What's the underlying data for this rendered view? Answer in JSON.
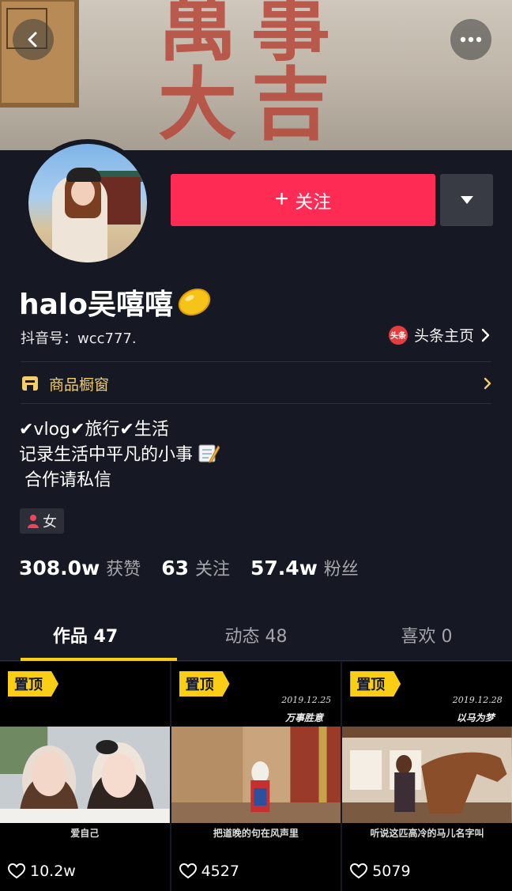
{
  "cover": {
    "calligraphy_line1": "萬事",
    "calligraphy_line2": "大吉"
  },
  "profile": {
    "follow_label": "关注",
    "nickname": "halo吴嘻嘻",
    "douyin_id": "抖音号：wcc777.",
    "toutiao_badge": "头条",
    "toutiao_label": "头条主页",
    "shop_label": "商品橱窗",
    "bio_lines": [
      "✔vlog✔旅行✔生活",
      "记录生活中平凡的小事",
      " 合作请私信"
    ],
    "gender": "女"
  },
  "stats": [
    {
      "num": "308.0w",
      "label": "获赞"
    },
    {
      "num": "63",
      "label": "关注"
    },
    {
      "num": "57.4w",
      "label": "粉丝"
    }
  ],
  "tabs": [
    {
      "label": "作品 47",
      "active": true
    },
    {
      "label": "动态 48",
      "active": false
    },
    {
      "label": "喜欢 0",
      "active": false
    }
  ],
  "videos": [
    {
      "pin": "置顶",
      "date": "",
      "top_text": "",
      "caption": "爱自己",
      "likes": "10.2w"
    },
    {
      "pin": "置顶",
      "date": "2019.12.25",
      "top_text": "万事胜意",
      "caption": "把道晚的句在风声里",
      "likes": "4527"
    },
    {
      "pin": "置顶",
      "date": "2019.12.28",
      "top_text": "以马为梦",
      "caption": "听说这匹高冷的马儿名字叫",
      "likes": "5079"
    }
  ],
  "colors": {
    "background": "#161823",
    "follow": "#fe2c55",
    "accent_yellow": "#face15",
    "shop_text": "#f1cd6b"
  }
}
